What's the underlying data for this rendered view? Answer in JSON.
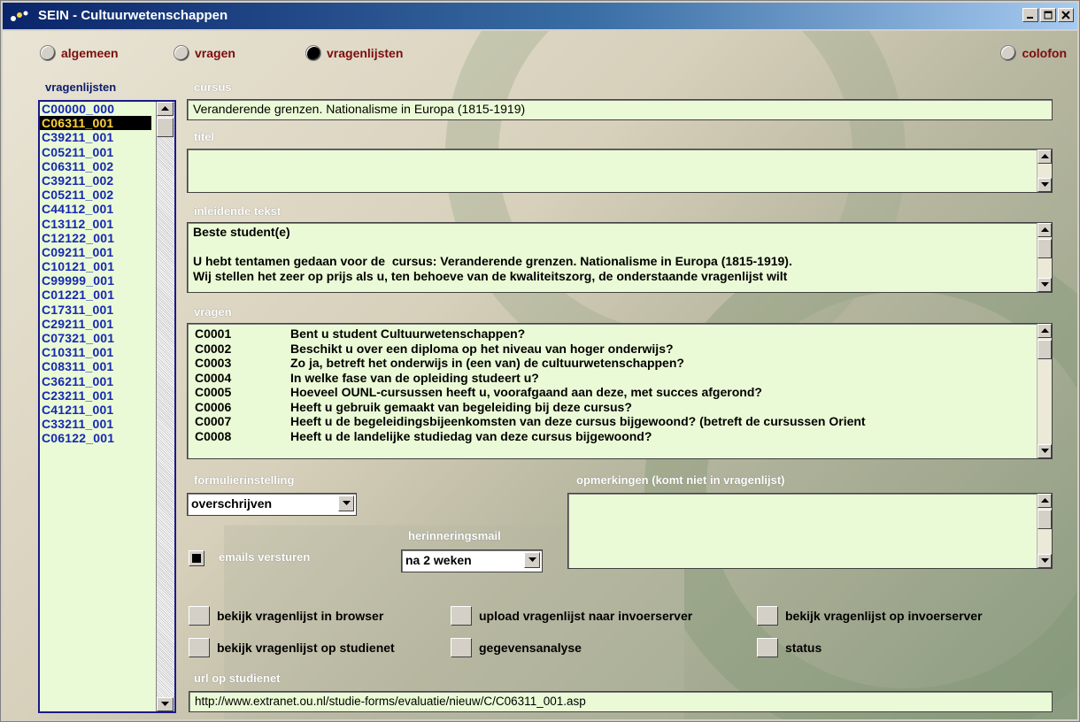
{
  "window": {
    "title": "SEIN - Cultuurwetenschappen",
    "controls": [
      "minimize",
      "maximize",
      "close"
    ]
  },
  "nav": {
    "items": [
      {
        "label": "algemeen",
        "selected": false
      },
      {
        "label": "vragen",
        "selected": false
      },
      {
        "label": "vragenlijsten",
        "selected": true
      },
      {
        "label": "colofon",
        "selected": false
      }
    ]
  },
  "sidebar": {
    "heading": "vragenlijsten",
    "items": [
      "C00000_000",
      "C06311_001",
      "C39211_001",
      "C05211_001",
      "C06311_002",
      "C39211_002",
      "C05211_002",
      "C44112_001",
      "C13112_001",
      "C12122_001",
      "C09211_001",
      "C10121_001",
      "C99999_001",
      "C01221_001",
      "C17311_001",
      "C29211_001",
      "C07321_001",
      "C10311_001",
      "C08311_001",
      "C36211_001",
      "C23211_001",
      "C41211_001",
      "C33211_001",
      "C06122_001"
    ],
    "selected": "C06311_001"
  },
  "cursus": {
    "label": "cursus",
    "value": "Veranderende grenzen. Nationalisme in Europa (1815-1919)"
  },
  "titel": {
    "label": "titel",
    "value": ""
  },
  "inleiding": {
    "label": "inleidende tekst",
    "value": "Beste student(e)\n\nU hebt tentamen gedaan voor de  cursus: Veranderende grenzen. Nationalisme in Europa (1815-1919).\nWij stellen het zeer op prijs als u, ten behoeve van de kwaliteitszorg, de onderstaande vragenlijst wilt"
  },
  "vragen": {
    "label": "vragen",
    "rows": [
      {
        "code": "C0001",
        "text": "Bent u student Cultuurwetenschappen?"
      },
      {
        "code": "C0002",
        "text": "Beschikt u over een diploma op het niveau van hoger onderwijs?"
      },
      {
        "code": "C0003",
        "text": "Zo ja, betreft het onderwijs in (een van) de cultuurwetenschappen?"
      },
      {
        "code": "C0004",
        "text": "In welke fase van de opleiding studeert u?"
      },
      {
        "code": "C0005",
        "text": "Hoeveel OUNL-cursussen heeft u, voorafgaand aan deze, met succes afgerond?"
      },
      {
        "code": "C0006",
        "text": "Heeft u gebruik gemaakt van begeleiding bij deze cursus?"
      },
      {
        "code": "C0007",
        "text": "Heeft u de begeleidingsbijeenkomsten van deze cursus bijgewoond? (betreft de cursussen Orient"
      },
      {
        "code": "C0008",
        "text": "Heeft u de landelijke studiedag van deze cursus bijgewoond?"
      }
    ]
  },
  "formulier": {
    "label": "formulierinstelling",
    "value": "overschrijven"
  },
  "emails": {
    "label": "emails versturen",
    "checked": true
  },
  "herinnering": {
    "label": "herinneringsmail",
    "value": "na 2 weken"
  },
  "opmerkingen": {
    "label": "opmerkingen (komt niet in vragenlijst)",
    "value": ""
  },
  "actions": {
    "browser": "bekijk vragenlijst in browser",
    "upload": "upload vragenlijst naar invoerserver",
    "invoerserver": "bekijk vragenlijst op invoerserver",
    "studienet": "bekijk vragenlijst op studienet",
    "analyse": "gegevensanalyse",
    "status": "status"
  },
  "url": {
    "label": "url op studienet",
    "value": "http://www.extranet.ou.nl/studie-forms/evaluatie/nieuw/C/C06311_001.asp"
  },
  "colors": {
    "titlebar_start": "#0a246a",
    "field_bg": "#ebfad6",
    "list_text": "#1428b4",
    "nav_text": "#7d0c0c",
    "selection_bg": "#000000",
    "selection_text": "#ffd23c"
  }
}
